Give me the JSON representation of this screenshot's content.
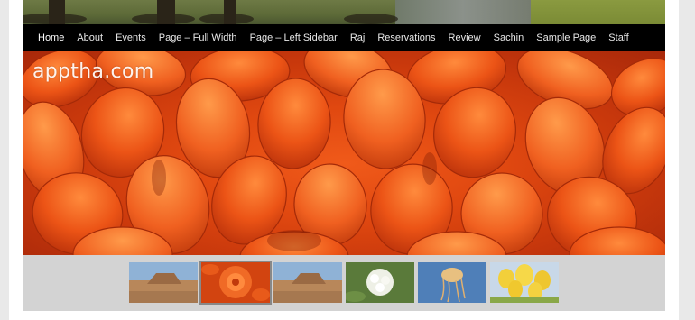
{
  "nav": {
    "items": [
      {
        "label": "Home",
        "active": true
      },
      {
        "label": "About"
      },
      {
        "label": "Events"
      },
      {
        "label": "Page – Full Width"
      },
      {
        "label": "Page – Left Sidebar"
      },
      {
        "label": "Raj"
      },
      {
        "label": "Reservations"
      },
      {
        "label": "Review"
      },
      {
        "label": "Sachin"
      },
      {
        "label": "Sample Page"
      },
      {
        "label": "Staff"
      }
    ]
  },
  "banner": {
    "logo_text": "apptha.com",
    "image": "orange-dahlia-petals"
  },
  "thumbnails": [
    {
      "name": "desert-rock-thumbnail",
      "selected": false
    },
    {
      "name": "orange-dahlia-thumbnail",
      "selected": true
    },
    {
      "name": "desert-rock-thumbnail-2",
      "selected": false
    },
    {
      "name": "white-hydrangea-thumbnail",
      "selected": false
    },
    {
      "name": "jellyfish-thumbnail",
      "selected": false
    },
    {
      "name": "yellow-tulips-thumbnail",
      "selected": false
    }
  ],
  "colors": {
    "nav_bg": "#000000",
    "thumb_strip_bg": "#d3d3d3",
    "banner_accent": "#e04810"
  }
}
